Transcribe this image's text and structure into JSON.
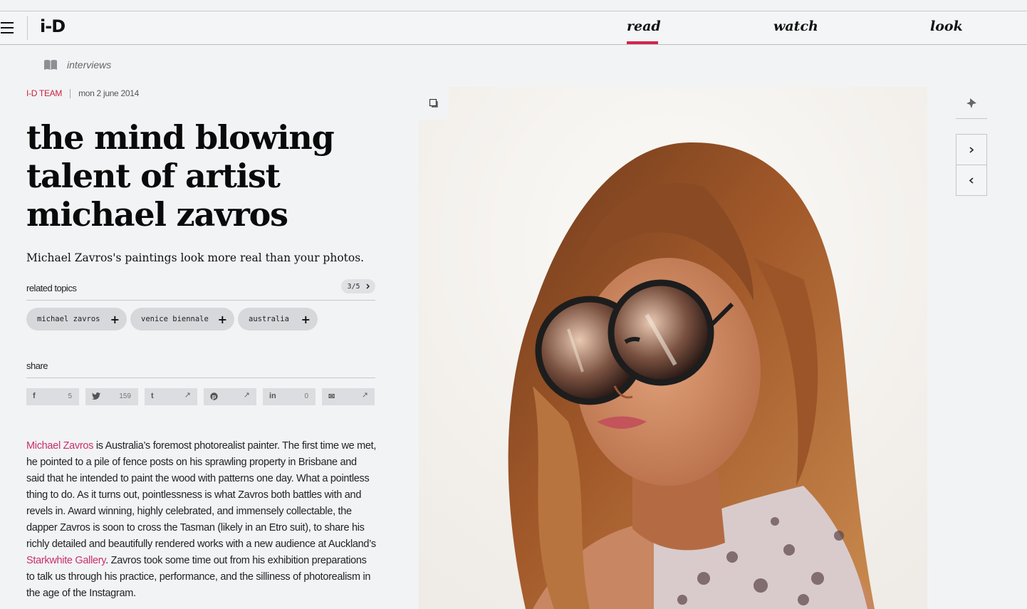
{
  "header": {
    "logo": "i-D",
    "nav": [
      {
        "label": "read",
        "active": true
      },
      {
        "label": "watch",
        "active": false
      },
      {
        "label": "look",
        "active": false
      }
    ],
    "accent_color": "#d2254d"
  },
  "article": {
    "category": "interviews",
    "author": "I-D TEAM",
    "date": "mon 2 june 2014",
    "title": "the mind blowing talent of artist michael zavros",
    "standfirst": "Michael Zavros's paintings look more real than your photos.",
    "related_topics": {
      "label": "related topics",
      "pager": "3/5",
      "tags": [
        "michael zavros",
        "venice biennale",
        "australia"
      ]
    },
    "share": {
      "label": "share",
      "buttons": [
        {
          "icon": "facebook-icon",
          "glyph": "f",
          "count": "5"
        },
        {
          "icon": "twitter-icon",
          "glyph": "t",
          "count": "159"
        },
        {
          "icon": "tumblr-icon",
          "glyph": "t",
          "count": ""
        },
        {
          "icon": "pinterest-icon",
          "glyph": "p",
          "count": ""
        },
        {
          "icon": "linkedin-icon",
          "glyph": "in",
          "count": "0"
        },
        {
          "icon": "email-icon",
          "glyph": "✉",
          "count": ""
        }
      ]
    },
    "body": {
      "link1": "Michael Zavros",
      "p1": " is Australia’s foremost photorealist painter. The first time we met, he pointed to a pile of fence posts on his sprawling property in Brisbane and said that he intended to paint the wood with patterns one day. What a pointless thing to do. As it turns out, pointlessness is what Zavros both battles with and revels in. Award winning, highly celebrated, and immensely collectable, the dapper Zavros is soon to cross the Tasman (likely in an Etro suit), to share his richly detailed and beautifully rendered works with a new audience at Auckland’s ",
      "link2": "Starkwhite Gallery",
      "p2": ". Zavros took some time out from his exhibition preparations to talk us through his practice, performance, and the silliness of photorealism in the age of the Instagram."
    }
  }
}
